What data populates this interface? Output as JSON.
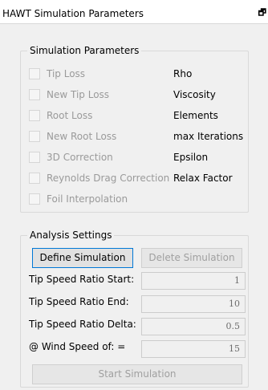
{
  "window": {
    "title": "HAWT Simulation Parameters",
    "float_icon": "restore-window-icon"
  },
  "simulation_parameters": {
    "title": "Simulation Parameters",
    "checkboxes": [
      {
        "label": "Tip Loss",
        "checked": false,
        "enabled": false
      },
      {
        "label": "New Tip Loss",
        "checked": false,
        "enabled": false
      },
      {
        "label": "Root Loss",
        "checked": false,
        "enabled": false
      },
      {
        "label": "New Root Loss",
        "checked": false,
        "enabled": false
      },
      {
        "label": "3D Correction",
        "checked": false,
        "enabled": false
      },
      {
        "label": "Reynolds Drag Correction",
        "checked": false,
        "enabled": false
      },
      {
        "label": "Foil Interpolation",
        "checked": false,
        "enabled": false
      }
    ],
    "params": [
      "Rho",
      "Viscosity",
      "Elements",
      "max Iterations",
      "Epsilon",
      "Relax Factor"
    ]
  },
  "analysis_settings": {
    "title": "Analysis Settings",
    "define_button": "Define Simulation",
    "delete_button": "Delete Simulation",
    "fields": [
      {
        "label": "Tip Speed Ratio Start:",
        "value": "1"
      },
      {
        "label": "Tip Speed Ratio End:",
        "value": "10"
      },
      {
        "label": "Tip Speed Ratio Delta:",
        "value": "0.5"
      },
      {
        "label": "@ Wind Speed of: =",
        "value": "15"
      }
    ],
    "start_button": "Start Simulation"
  }
}
